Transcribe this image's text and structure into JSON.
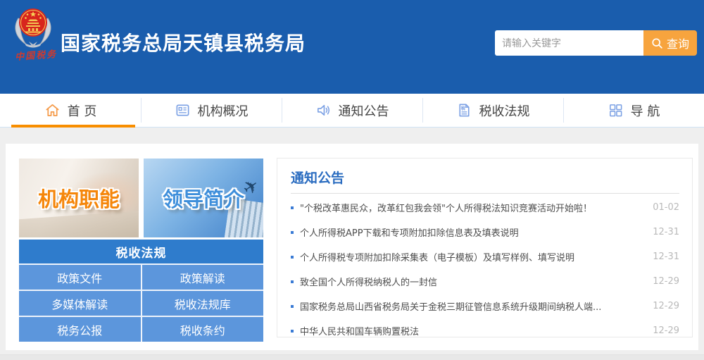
{
  "header": {
    "title": "国家税务总局天镇县税务局",
    "logo_caption": "中国税务",
    "search": {
      "placeholder": "请输入关键字",
      "button_label": "查询"
    }
  },
  "nav": {
    "tabs": [
      {
        "label": "首 页",
        "icon": "home-icon",
        "active": true
      },
      {
        "label": "机构概况",
        "icon": "document-icon",
        "active": false
      },
      {
        "label": "通知公告",
        "icon": "speaker-icon",
        "active": false
      },
      {
        "label": "税收法规",
        "icon": "tax-document-icon",
        "active": false
      },
      {
        "label": "导 航",
        "icon": "grid-icon",
        "active": false
      }
    ]
  },
  "banners": [
    {
      "label": "机构职能"
    },
    {
      "label": "领导简介"
    }
  ],
  "law_box": {
    "title": "税收法规",
    "links": [
      "政策文件",
      "政策解读",
      "多媒体解读",
      "税收法规库",
      "税务公报",
      "税收条约"
    ]
  },
  "notices": {
    "title": "通知公告",
    "items": [
      {
        "text": "\"个税改革惠民众，改革红包我会领\"个人所得税法知识竞赛活动开始啦！",
        "date": "01-02"
      },
      {
        "text": "个人所得税APP下载和专项附加扣除信息表及填表说明",
        "date": "12-31"
      },
      {
        "text": "个人所得税专项附加扣除采集表（电子模板）及填写样例、填写说明",
        "date": "12-31"
      },
      {
        "text": "致全国个人所得税纳税人的一封信",
        "date": "12-29"
      },
      {
        "text": "国家税务总局山西省税务局关于金税三期征管信息系统升级期间纳税人端...",
        "date": "12-29"
      },
      {
        "text": "中华人民共和国车辆购置税法",
        "date": "12-29"
      }
    ]
  },
  "colors": {
    "header_blue": "#1a5dad",
    "accent_orange": "#f88e00",
    "search_button_orange": "#f7a43e",
    "law_header_blue": "#2f7ccc",
    "law_cell_blue": "#5c96dc",
    "notice_title_blue": "#2a6cc0",
    "page_background": "#efefef"
  }
}
